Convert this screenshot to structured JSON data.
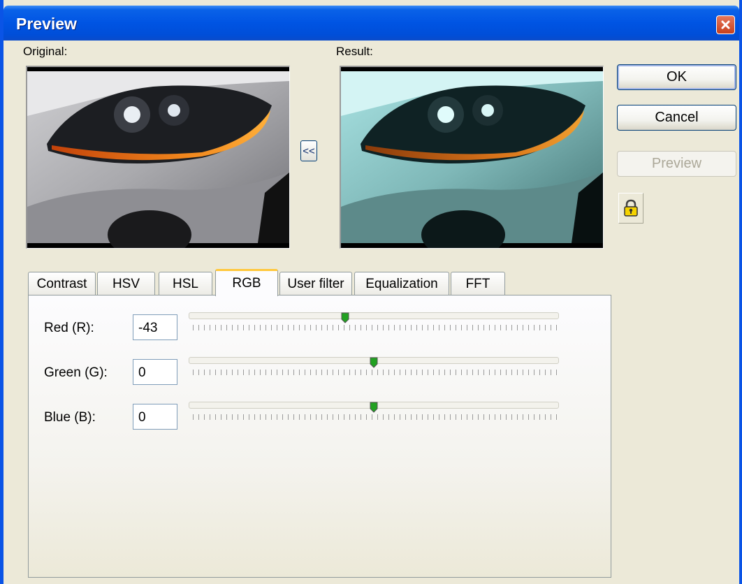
{
  "window": {
    "title": "Preview",
    "close_icon": "close-icon"
  },
  "images": {
    "original_label": "Original:",
    "result_label": "Result:",
    "copy_button_label": "<<"
  },
  "buttons": {
    "ok": "OK",
    "cancel": "Cancel",
    "preview": "Preview",
    "lock_icon": "lock-icon"
  },
  "tabs": [
    {
      "label": "Contrast",
      "active": false
    },
    {
      "label": "HSV",
      "active": false
    },
    {
      "label": "HSL",
      "active": false
    },
    {
      "label": "RGB",
      "active": true
    },
    {
      "label": "User filter",
      "active": false
    },
    {
      "label": "Equalization",
      "active": false
    },
    {
      "label": "FFT",
      "active": false
    }
  ],
  "rgb": {
    "red": {
      "label": "Red (R):",
      "value": "-43",
      "slider_fraction": 0.42
    },
    "green": {
      "label": "Green (G):",
      "value": "0",
      "slider_fraction": 0.5
    },
    "blue": {
      "label": "Blue (B):",
      "value": "0",
      "slider_fraction": 0.5
    }
  },
  "colors": {
    "title_bar": "#0054e3",
    "dialog_bg": "#ece9d8",
    "active_tab_highlight": "#ffc83c",
    "slider_thumb": "#21a121"
  }
}
